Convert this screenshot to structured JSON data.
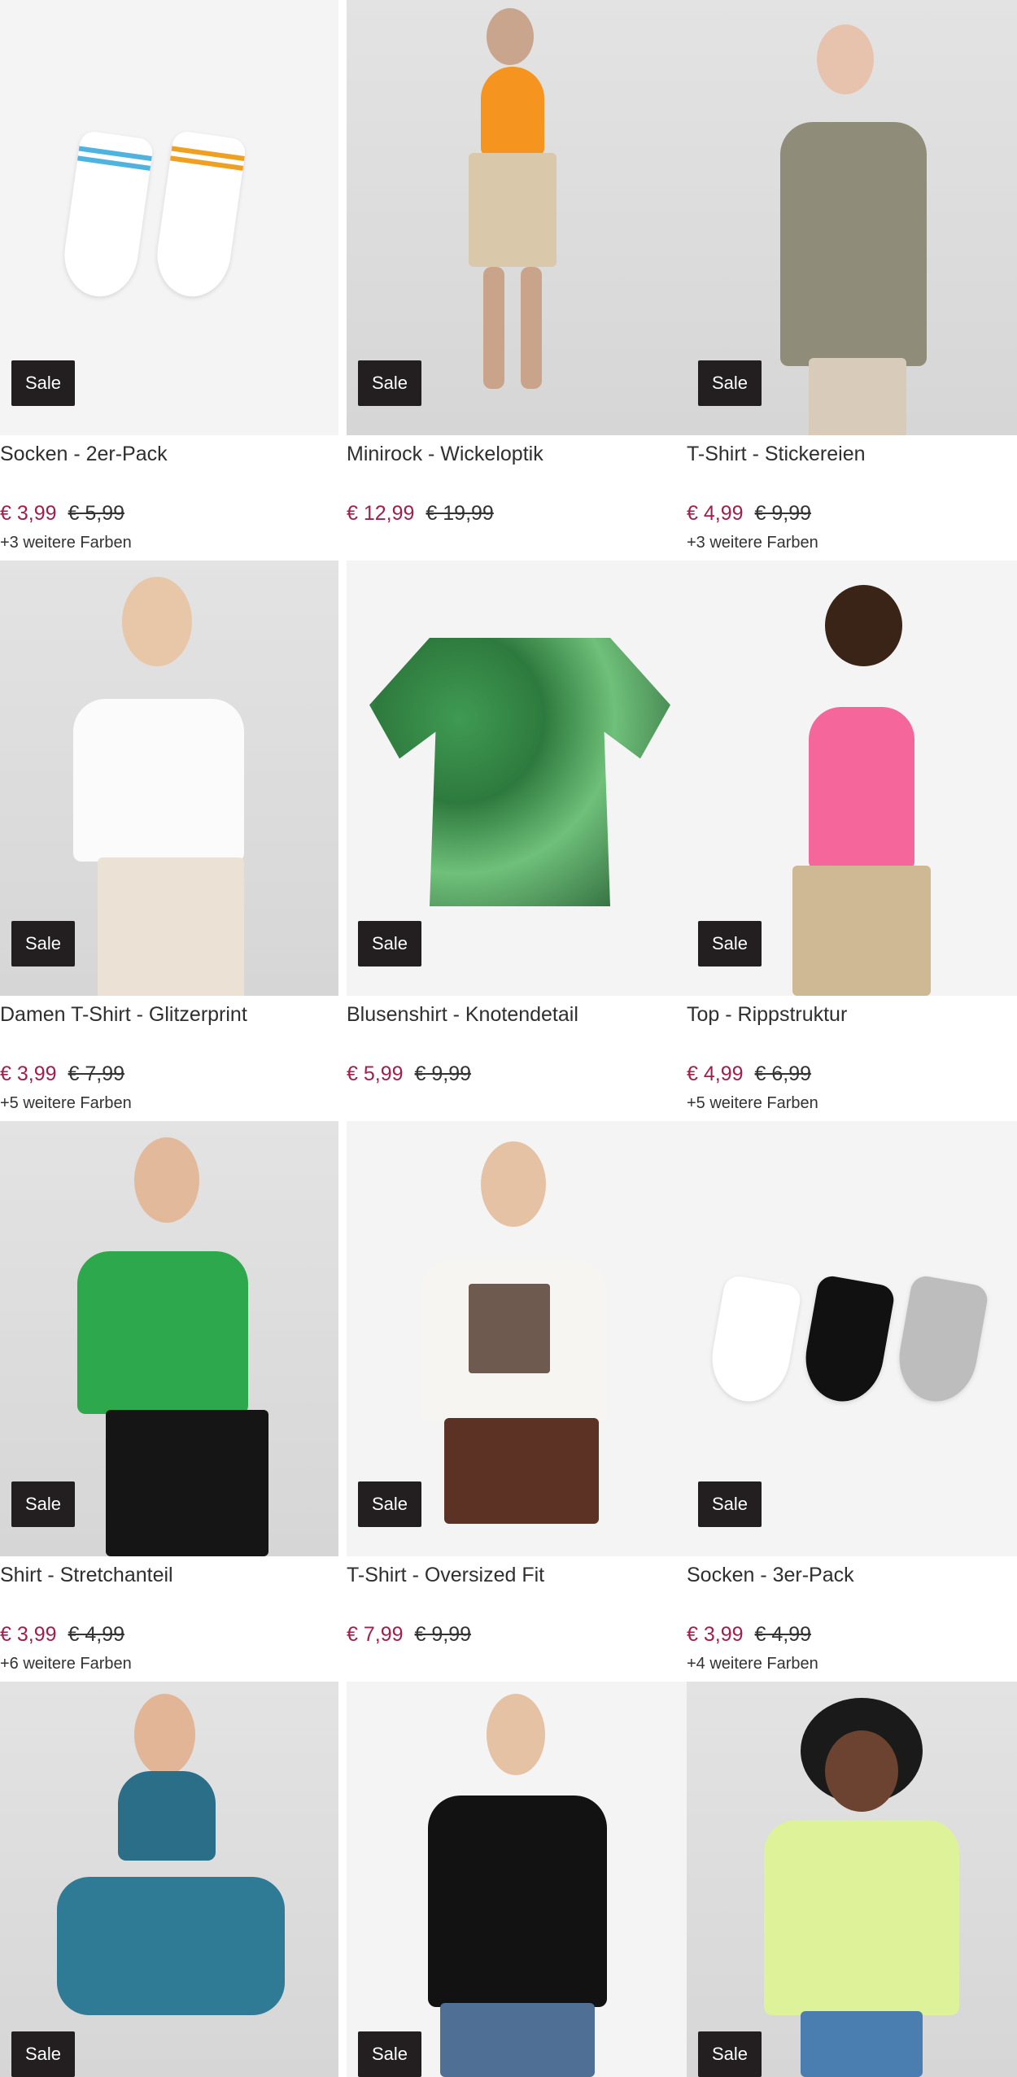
{
  "products": [
    {
      "title": "Socken - 2er-Pack",
      "price": "€ 3,99",
      "old_price": "€ 5,99",
      "colors": "+3 weitere Farben",
      "badge": "Sale"
    },
    {
      "title": "Minirock - Wickeloptik",
      "price": "€ 12,99",
      "old_price": "€ 19,99",
      "colors": "",
      "badge": "Sale"
    },
    {
      "title": "T-Shirt - Stickereien",
      "price": "€ 4,99",
      "old_price": "€ 9,99",
      "colors": "+3 weitere Farben",
      "badge": "Sale"
    },
    {
      "title": "Damen T-Shirt - Glitzerprint",
      "price": "€ 3,99",
      "old_price": "€ 7,99",
      "colors": "+5 weitere Farben",
      "badge": "Sale"
    },
    {
      "title": "Blusenshirt - Knotendetail",
      "price": "€ 5,99",
      "old_price": "€ 9,99",
      "colors": "",
      "badge": "Sale"
    },
    {
      "title": "Top - Rippstruktur",
      "price": "€ 4,99",
      "old_price": "€ 6,99",
      "colors": "+5 weitere Farben",
      "badge": "Sale"
    },
    {
      "title": "Shirt - Stretchanteil",
      "price": "€ 3,99",
      "old_price": "€ 4,99",
      "colors": "+6 weitere Farben",
      "badge": "Sale"
    },
    {
      "title": "T-Shirt - Oversized Fit",
      "price": "€ 7,99",
      "old_price": "€ 9,99",
      "colors": "",
      "badge": "Sale"
    },
    {
      "title": "Socken - 3er-Pack",
      "price": "€ 3,99",
      "old_price": "€ 4,99",
      "colors": "+4 weitere Farben",
      "badge": "Sale"
    },
    {
      "title": "",
      "price": "",
      "old_price": "",
      "colors": "",
      "badge": "Sale"
    },
    {
      "title": "",
      "price": "",
      "old_price": "",
      "colors": "",
      "badge": "Sale"
    },
    {
      "title": "",
      "price": "",
      "old_price": "",
      "colors": "",
      "badge": "Sale"
    }
  ],
  "colors": {
    "sale_badge_bg": "#231f20",
    "price_current": "#a0204a",
    "text": "#2f2f2f"
  }
}
